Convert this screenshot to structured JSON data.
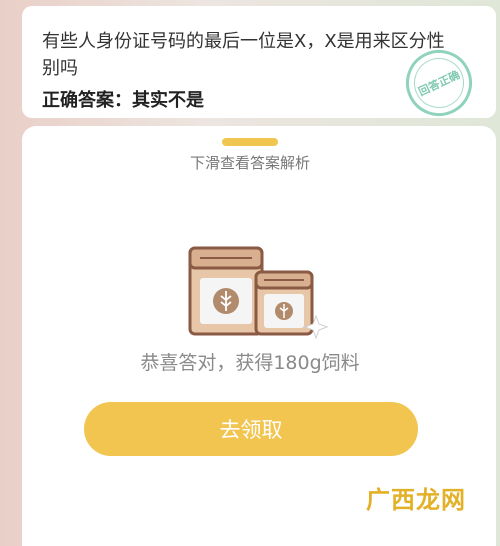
{
  "question": {
    "text": "有些人身份证号码的最后一位是X，X是用来区分性别吗",
    "answer_label": "正确答案：",
    "answer_value": "其实不是",
    "stamp_text": "回答正确"
  },
  "sheet": {
    "hint": "下滑查看答案解析",
    "reward_text": "恭喜答对，获得180g饲料",
    "claim_label": "去领取"
  },
  "watermark": "广西龙网",
  "colors": {
    "accent_yellow": "#f2c550",
    "stamp_green": "#8fd3bd",
    "bag_brown": "#8a5a44",
    "bag_tan": "#e8c7a8"
  }
}
